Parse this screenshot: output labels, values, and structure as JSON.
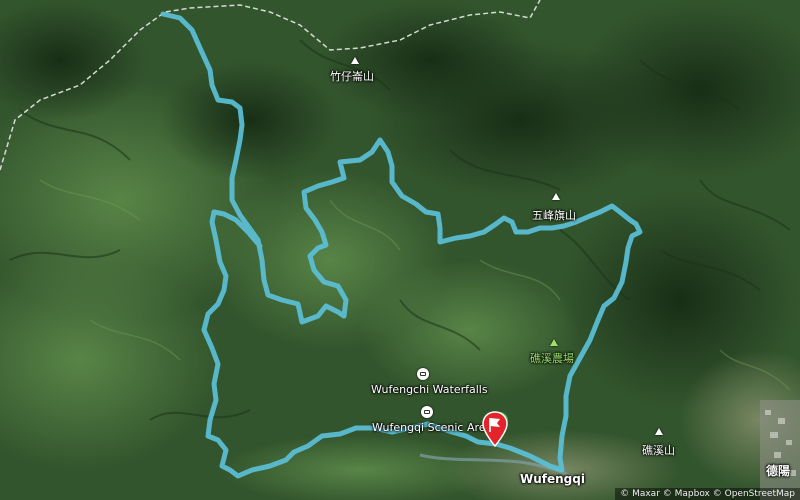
{
  "labels": {
    "peak_zhuzaizhaishan": "竹仔崙山",
    "peak_wufengqishan": "五峰旗山",
    "farm_jiaoxi": "礁溪農場",
    "waterfalls": "Wufengchi Waterfalls",
    "scenic_area": "Wufengqi Scenic Area",
    "town": "Wufengqi",
    "peak_jiaoxishan": "礁溪山",
    "town_partial": "德陽"
  },
  "attribution": "© Maxar © Mapbox © OpenStreetMap",
  "colors": {
    "route": "#5bc0d8",
    "pin": "#e3242b",
    "boundary": "#e8e8e8",
    "terrain_dark": "#1f3a1e",
    "terrain_mid": "#3d6534",
    "terrain_light": "#5b8547"
  },
  "icons": {
    "peak": "triangle-peak-icon",
    "viewpoint": "camera-icon",
    "start": "flag-pin-icon"
  }
}
